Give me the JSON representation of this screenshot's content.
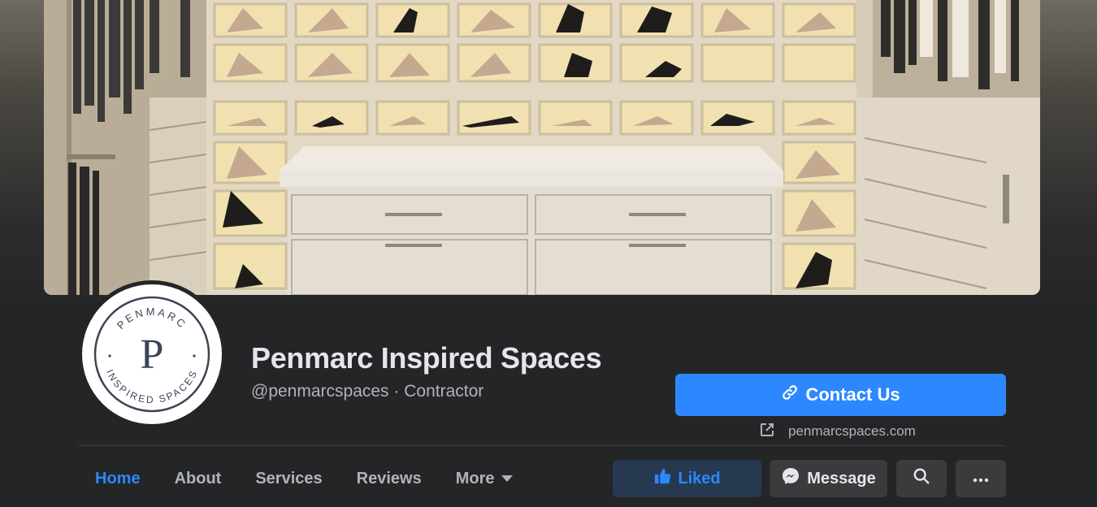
{
  "page": {
    "name": "Penmarc Inspired Spaces",
    "handle": "@penmarcspaces",
    "separator": "·",
    "category": "Contractor"
  },
  "avatar": {
    "logo_top_text": "PENMARC",
    "logo_letter": "P",
    "logo_bottom_text": "INSPIRED SPACES"
  },
  "cover": {
    "icon": "closet-photo",
    "colors": {
      "wood": "#ddd3c0",
      "lit_shelf": "#f1dfae",
      "island": "#e6e0d6"
    }
  },
  "contact": {
    "label": "Contact Us",
    "icon": "link-icon"
  },
  "website": {
    "label": "penmarcspaces.com",
    "icon": "external-link-icon"
  },
  "tabs": [
    {
      "label": "Home",
      "active": true
    },
    {
      "label": "About",
      "active": false
    },
    {
      "label": "Services",
      "active": false
    },
    {
      "label": "Reviews",
      "active": false
    },
    {
      "label": "More",
      "active": false,
      "has_caret": true
    }
  ],
  "actions": {
    "liked_label": "Liked",
    "message_label": "Message",
    "search_icon": "search-icon",
    "more_icon": "ellipsis-icon"
  },
  "colors": {
    "background": "#242526",
    "accent": "#2d88ff",
    "liked_bg": "#263951",
    "secondary_button": "#3a3b3c",
    "text_primary": "#e4e6eb",
    "text_secondary": "#b0b3b8"
  }
}
